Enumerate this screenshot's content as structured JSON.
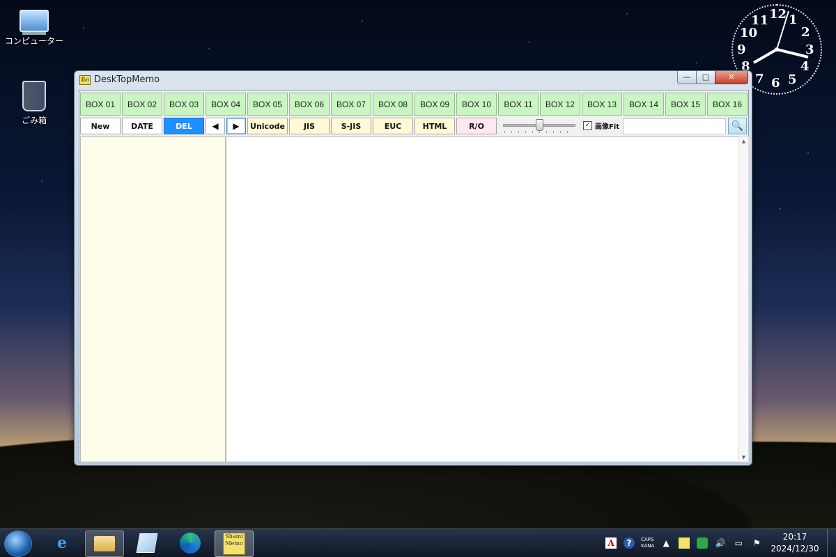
{
  "desktop": {
    "icons": [
      {
        "label": "コンピューター"
      },
      {
        "label": "ごみ箱"
      }
    ],
    "clock_numbers": [
      "12",
      "1",
      "2",
      "3",
      "4",
      "5",
      "6",
      "7",
      "8",
      "9",
      "10",
      "11"
    ]
  },
  "window": {
    "title": "DeskTopMemo",
    "app_icon_text": "あn",
    "controls": {
      "minimize": "—",
      "maximize": "□",
      "close": "✕"
    },
    "boxes": [
      "BOX 01",
      "BOX 02",
      "BOX 03",
      "BOX 04",
      "BOX 05",
      "BOX 06",
      "BOX 07",
      "BOX 08",
      "BOX 09",
      "BOX 10",
      "BOX 11",
      "BOX 12",
      "BOX 13",
      "BOX 14",
      "BOX 15",
      "BOX 16"
    ],
    "toolbar": {
      "new": "New",
      "date": "DATE",
      "del": "DEL",
      "prev": "◀",
      "next": "▶",
      "unicode": "Unicode",
      "jis": "JIS",
      "sjis": "S-JIS",
      "euc": "EUC",
      "html": "HTML",
      "ro": "R/O"
    },
    "fit_label": "画像Fit",
    "fit_checked": "✓",
    "search_value": "",
    "search_icon": "🔍",
    "zoom_slider_level": 0.5
  },
  "taskbar": {
    "apps": [
      "Internet Explorer",
      "エクスプローラー",
      "メモ",
      "Microsoft Edge",
      "Shami Memo"
    ],
    "ie_glyph": "e",
    "memo_icon_text": "Shami Memo",
    "tray": {
      "adobe": "A",
      "help": "?",
      "caps": "CAPS",
      "kana": "KANA",
      "chevron": "▲"
    },
    "time": "20:17",
    "date": "2024/12/30"
  }
}
